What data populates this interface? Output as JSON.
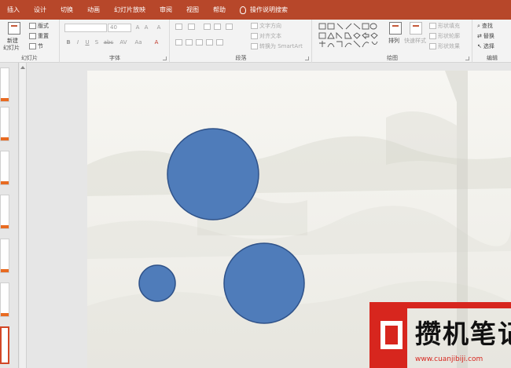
{
  "tabs": [
    "插入",
    "设计",
    "切换",
    "动画",
    "幻灯片放映",
    "审阅",
    "视图",
    "帮助",
    "操作说明搜索"
  ],
  "ribbon": {
    "slides_group": {
      "label": "幻灯片",
      "new_slide": "新建",
      "new_slide2": "幻灯片",
      "layout": "版式",
      "reset": "重置",
      "section": "节"
    },
    "font_group": {
      "label": "字体",
      "font_size": "40",
      "bold": "B",
      "italic": "I",
      "underline": "U",
      "strike": "S",
      "shadow": "abc",
      "spacing": "AV",
      "case": "Aa",
      "grow": "A",
      "shrink": "A",
      "clear": "A",
      "color": "A"
    },
    "paragraph_group": {
      "label": "段落",
      "text_direction": "文字方向",
      "align_text": "对齐文本",
      "smartart": "转换为 SmartArt"
    },
    "drawing_group": {
      "label": "绘图",
      "arrange": "排列",
      "quick_styles": "快速样式",
      "shape_fill": "形状填充",
      "shape_outline": "形状轮廓",
      "shape_effects": "形状效果"
    },
    "editing_group": {
      "label": "编辑",
      "find": "查找",
      "replace": "替换",
      "select": "选择"
    }
  },
  "slide": {
    "circles": [
      {
        "name": "circle-large-top",
        "fill": "#4f7cba"
      },
      {
        "name": "circle-small",
        "fill": "#4f7cba"
      },
      {
        "name": "circle-large-bottom",
        "fill": "#4f7cba"
      }
    ]
  },
  "watermark": {
    "text": "攒机笔记",
    "url": "www.cuanjibiji.com",
    "color": "#d7261e"
  }
}
